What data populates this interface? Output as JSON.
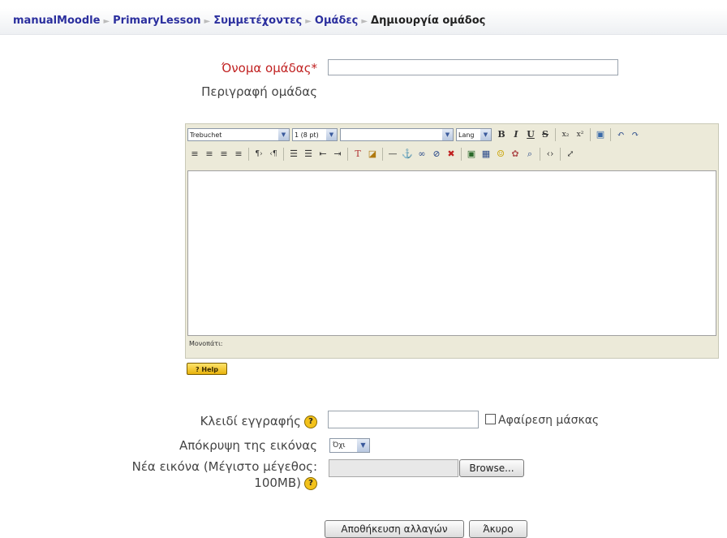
{
  "breadcrumb": {
    "items": [
      "manualMoodle",
      "PrimaryLesson",
      "Συμμετέχοντες",
      "Ομάδες"
    ],
    "current": "Δημιουργία ομάδος",
    "separator": "►"
  },
  "form": {
    "group_name_label": "Όνομα ομάδας*",
    "group_name_value": "",
    "description_label": "Περιγραφή ομάδας",
    "enrolment_key_label": "Κλειδί εγγραφής",
    "enrolment_key_value": "",
    "unmask_label": "Αφαίρεση μάσκας",
    "hide_picture_label": "Απόκρυψη της εικόνας",
    "hide_picture_value": "Όχι",
    "new_picture_label_line1": "Νέα εικόνα (Μέγιστο μέγεθος:",
    "new_picture_label_line2": "100MB)",
    "browse_label": "Browse...",
    "save_label": "Αποθήκευση αλλαγών",
    "cancel_label": "Άκυρο"
  },
  "editor": {
    "font_family": "Trebuchet",
    "font_size": "1 (8 pt)",
    "heading": "",
    "lang": "Lang",
    "path_label": "Μονοπάτι:",
    "help_button": "? Help"
  },
  "colors": {
    "breadcrumb_link": "#2b2f9e",
    "required_label": "#c12222",
    "toolbar_bg": "#ecead9"
  }
}
